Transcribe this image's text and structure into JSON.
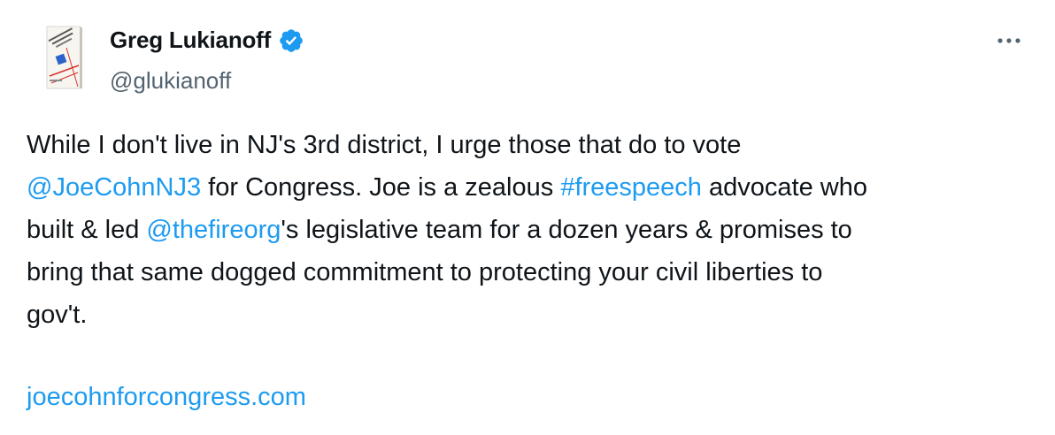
{
  "author": {
    "display_name": "Greg Lukianoff",
    "handle": "@glukianoff",
    "verified_icon": "verified-badge-icon",
    "avatar_icon": "book-cover-avatar",
    "avatar_title": "The Canceling of the American Mind"
  },
  "menu": {
    "more_icon": "more-icon"
  },
  "tweet": {
    "t1": "While I don't live in NJ's 3rd district, I urge those that do to vote",
    "m1": "@JoeCohnNJ3",
    "t2": " for Congress. Joe is a zealous ",
    "h1": "#freespeech",
    "t3": " advocate who",
    "t4": "built & led ",
    "m2": "@thefireorg",
    "t5": "'s legislative team for a dozen years & promises to",
    "t6": "bring that same dogged commitment to protecting your civil liberties to",
    "t7": "gov't.",
    "url": "joecohnforcongress.com"
  },
  "colors": {
    "text": "#0f1419",
    "secondary": "#536471",
    "link": "#1d9bf0"
  }
}
